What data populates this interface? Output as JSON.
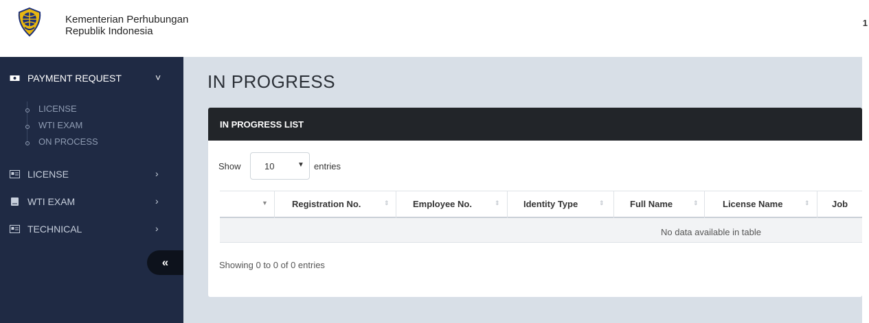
{
  "header": {
    "org_line1": "Kementerian Perhubungan",
    "org_line2": "Republik Indonesia",
    "right_text": "1"
  },
  "sidebar": {
    "items": [
      {
        "label": "PAYMENT REQUEST",
        "icon": "money-icon",
        "expanded": true
      },
      {
        "label": "LICENSE",
        "icon": "id-card-icon"
      },
      {
        "label": "WTI EXAM",
        "icon": "book-icon"
      },
      {
        "label": "TECHNICAL",
        "icon": "id-card-icon"
      }
    ],
    "sub_items": [
      "LICENSE",
      "WTI EXAM",
      "ON PROCESS"
    ],
    "collapse_label": "«"
  },
  "main": {
    "title": "IN PROGRESS",
    "card_title": "IN PROGRESS LIST",
    "show_label": "Show",
    "page_size": "10",
    "entries_label": "entries",
    "columns": [
      "",
      "Registration No.",
      "Employee No.",
      "Identity Type",
      "Full Name",
      "License Name",
      "Job"
    ],
    "empty_message": "No data available in table",
    "info": "Showing 0 to 0 of 0 entries"
  },
  "colors": {
    "sidebar_bg": "#1f2a44",
    "card_header_bg": "#222529",
    "content_bg": "#d8dfe7"
  }
}
